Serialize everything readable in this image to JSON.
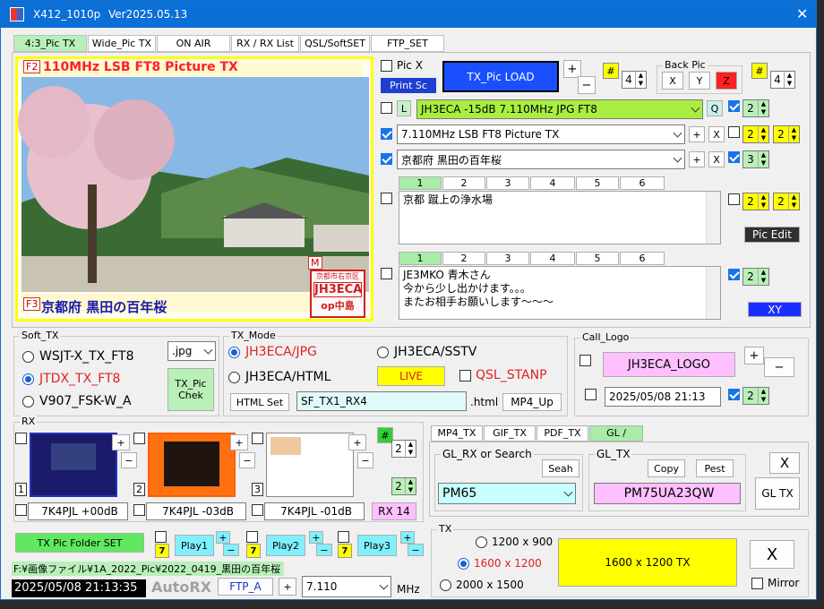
{
  "window": {
    "title": "X412_1010p",
    "version": "Ver2025.05.13",
    "close": "✕"
  },
  "tabs": [
    "4:3_Pic TX",
    "Wide_Pic TX",
    "ON AIR",
    "RX / RX List",
    "QSL/SoftSET",
    "FTP_SET"
  ],
  "picture": {
    "top_text": "110MHz  LSB  FT8 Picture TX",
    "bottom_text": "京都府  黒田の百年桜",
    "f2": "F2",
    "f3": "F3",
    "m": "M",
    "stamp_top": "京都市右京区",
    "stamp_call": "JH3ECA",
    "stamp_op": "op中島"
  },
  "right": {
    "pic_x": "Pic X",
    "print_sc": "Print Sc",
    "tx_pic_load": "TX_Pic  LOAD",
    "plus": "+",
    "minus": "−",
    "hash": "#",
    "spin4": "4",
    "back_pic": "Back Pic",
    "x": "X",
    "y": "Y",
    "z": "Z",
    "l_btn": "L",
    "line1": "JH3ECA  -15dB  7.110MHz  JPG  FT8",
    "q": "Q",
    "line2": "7.110MHz  LSB  FT8 Picture TX",
    "line3": "京都府  黒田の百年桜",
    "two": "2",
    "three": "3",
    "close_x": "X",
    "numtabs": [
      "1",
      "2",
      "3",
      "4",
      "5",
      "6"
    ],
    "memo1": "京都 蹴上の浄水場",
    "pic_edit": "Pic  Edit",
    "memo2_l1": "JE3MKO   青木さん",
    "memo2_l2": "今から少し出かけます。。。",
    "memo2_l3": "またお相手お願いします～～～",
    "xy": "XY"
  },
  "soft_tx": {
    "title": "Soft_TX",
    "options": [
      "WSJT-X_TX_FT8",
      "JTDX_TX_FT8",
      "V907_FSK-W_A"
    ],
    "selected": 1,
    "format": ".jpg",
    "tx_pic_chek": "TX_Pic Chek"
  },
  "tx_mode": {
    "title": "TX_Mode",
    "opt1": "JH3ECA/JPG",
    "opt2": "JH3ECA/SSTV",
    "opt3": "JH3ECA/HTML",
    "live": "LIVE",
    "qsl_stanp": "QSL_STANP",
    "html_set": "HTML Set",
    "file": "SF_TX1_RX4",
    "ext": ".html",
    "mp4_up": "MP4_Up"
  },
  "call_logo": {
    "title": "Call_Logo",
    "logo": "JH3ECA_LOGO",
    "datetime": "2025/05/08  21:13",
    "spin": "2"
  },
  "rx": {
    "title": "RX",
    "labels": [
      "7K4PJL  +00dB",
      "7K4PJL  -03dB",
      "7K4PJL  -01dB"
    ],
    "nums": [
      "1",
      "2",
      "3"
    ],
    "rx14": "RX 14",
    "hash": "#",
    "spin": "2"
  },
  "bottom": {
    "folder_set": "TX Pic  Folder SET",
    "play": [
      "Play1",
      "Play2",
      "Play3"
    ],
    "seven": "7",
    "path": "F:¥画像ファイル¥1A_2022_Pic¥2022_0419_黒田の百年桜",
    "clock": "2025/05/08  21:13:35",
    "autorx": "AutoRX",
    "ftp_a": "FTP_A",
    "freq": "7.110",
    "mhz": "MHz"
  },
  "gl": {
    "tabs": [
      "MP4_TX",
      "GIF_TX",
      "PDF_TX",
      "GL /"
    ],
    "rx_title": "GL_RX or Search",
    "seah": "Seah",
    "grid": "PM65",
    "tx_title": "GL_TX",
    "copy": "Copy",
    "pest": "Pest",
    "tx_grid": "PM75UA23QW",
    "x": "X",
    "gl_tx": "GL TX"
  },
  "tx": {
    "title": "TX",
    "sizes": [
      "1200 x 900",
      "1600 x 1200",
      "2000 x 1500"
    ],
    "selected": 1,
    "tx_btn": "1600 x 1200   TX",
    "x": "X",
    "mirror": "Mirror"
  }
}
